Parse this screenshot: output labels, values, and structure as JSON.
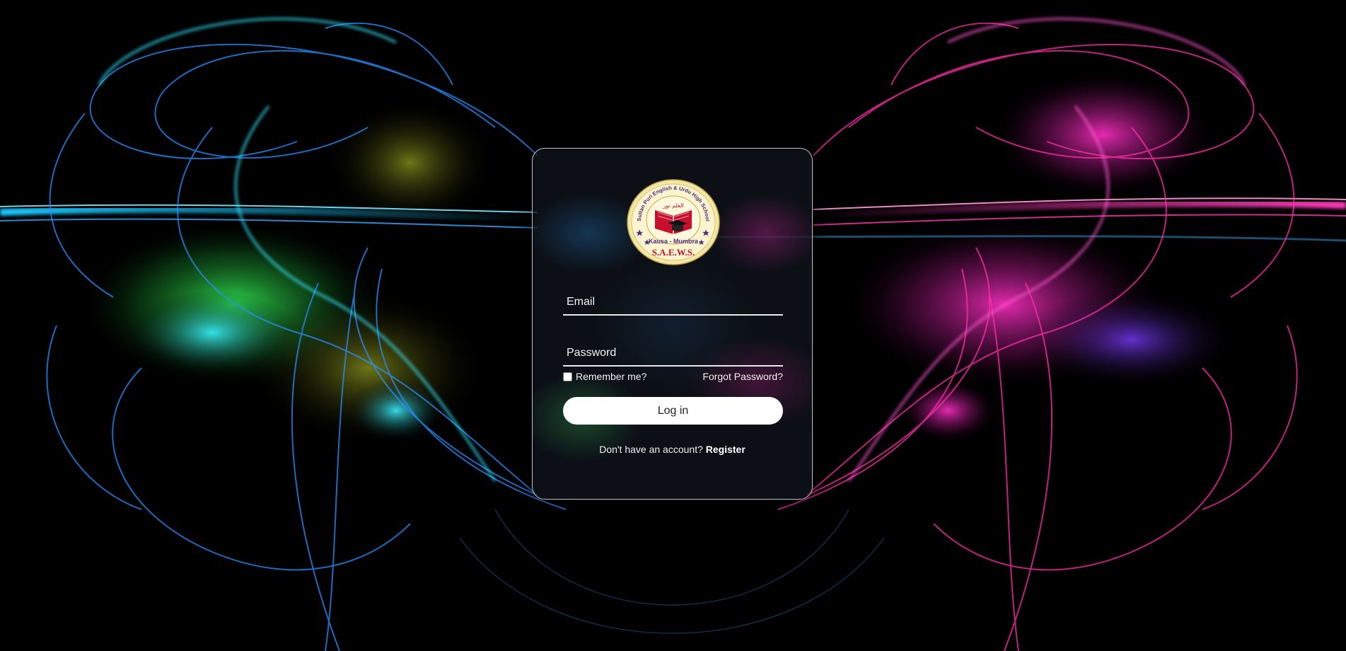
{
  "logo": {
    "ring_text": "Sultan Puri English & Urdu High School",
    "arabic_text": "العلم نور",
    "place_text": "Kausa - Mumbra",
    "org_text": "S.A.E.W.S."
  },
  "form": {
    "email_placeholder": "Email",
    "email_value": "",
    "password_placeholder": "Password",
    "password_value": "",
    "remember_label": "Remember me?",
    "forgot_label": "Forgot Password?",
    "login_label": "Log in",
    "no_account_text": "Don't have an account? ",
    "register_label": "Register"
  },
  "colors": {
    "background": "#000000",
    "card_border": "#e8e8e8",
    "button_bg": "#ffffff",
    "text_light": "#f0f0f0",
    "logo_red": "#c8102e",
    "logo_purple": "#4b2a7b",
    "logo_gold": "#e8c64a"
  }
}
